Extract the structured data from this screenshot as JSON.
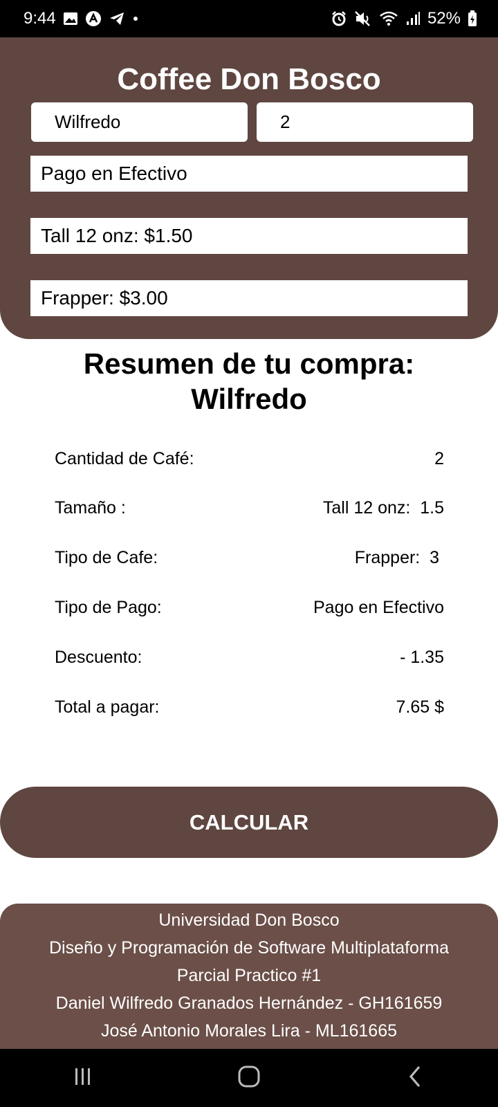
{
  "status_bar": {
    "time": "9:44",
    "battery": "52%",
    "left_icons": [
      "gallery-icon",
      "app-a-icon",
      "telegram-icon",
      "dot-icon"
    ],
    "right_icons": [
      "alarm-icon",
      "mute-icon",
      "wifi-icon",
      "signal-icon",
      "battery-icon"
    ]
  },
  "header": {
    "title": "Coffee Don Bosco",
    "name_value": "Wilfredo",
    "quantity_value": "2",
    "payment_select": "Pago en Efectivo",
    "size_select": "Tall 12 onz: $1.50",
    "type_select": "Frapper: $3.00"
  },
  "summary": {
    "title_line1": "Resumen de tu compra:",
    "title_line2": "Wilfredo",
    "rows": [
      {
        "label": "Cantidad de Café:",
        "value": "2"
      },
      {
        "label": "Tamaño :",
        "value": "Tall 12 onz:  1.5"
      },
      {
        "label": "Tipo de Cafe:",
        "value": "Frapper:  3 "
      },
      {
        "label": "Tipo de Pago:",
        "value": "Pago en Efectivo"
      },
      {
        "label": "Descuento:",
        "value": "- 1.35"
      },
      {
        "label": "Total a pagar:",
        "value": "7.65 $"
      }
    ]
  },
  "actions": {
    "calculate_label": "CALCULAR"
  },
  "footer": {
    "lines": [
      "Universidad Don Bosco",
      "Diseño y Programación de Software Multiplataforma",
      "Parcial Practico #1",
      "Daniel Wilfredo Granados Hernández - GH161659",
      "José Antonio Morales Lira - ML161665"
    ]
  },
  "nav_bar": {
    "icons": [
      "recent-apps-icon",
      "home-icon",
      "back-icon"
    ]
  },
  "colors": {
    "brand_brown": "#5f4640",
    "footer_brown": "#6b4f48"
  }
}
